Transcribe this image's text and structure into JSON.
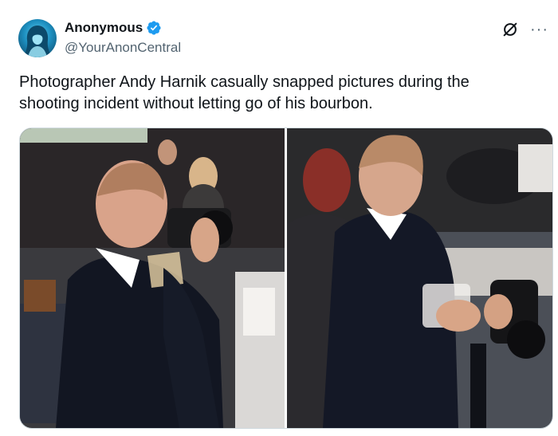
{
  "author": {
    "display_name": "Anonymous",
    "handle": "@YourAnonCentral",
    "verified": true,
    "avatar_icon": "anonymous-hood-avatar"
  },
  "actions": {
    "grok_icon": "grok-icon",
    "more_icon": "more-icon",
    "more_label": "···"
  },
  "tweet": {
    "text": "Photographer Andy Harnik casually snapped pictures during the shooting incident without letting go of his bourbon."
  },
  "media": {
    "images": [
      {
        "name": "photo-photographer-drinking",
        "description_icon": "photo"
      },
      {
        "name": "photo-photographer-holding-glass",
        "description_icon": "photo"
      }
    ]
  },
  "colors": {
    "verified_blue": "#1d9bf0",
    "text_primary": "#0f1419",
    "text_secondary": "#536471"
  }
}
